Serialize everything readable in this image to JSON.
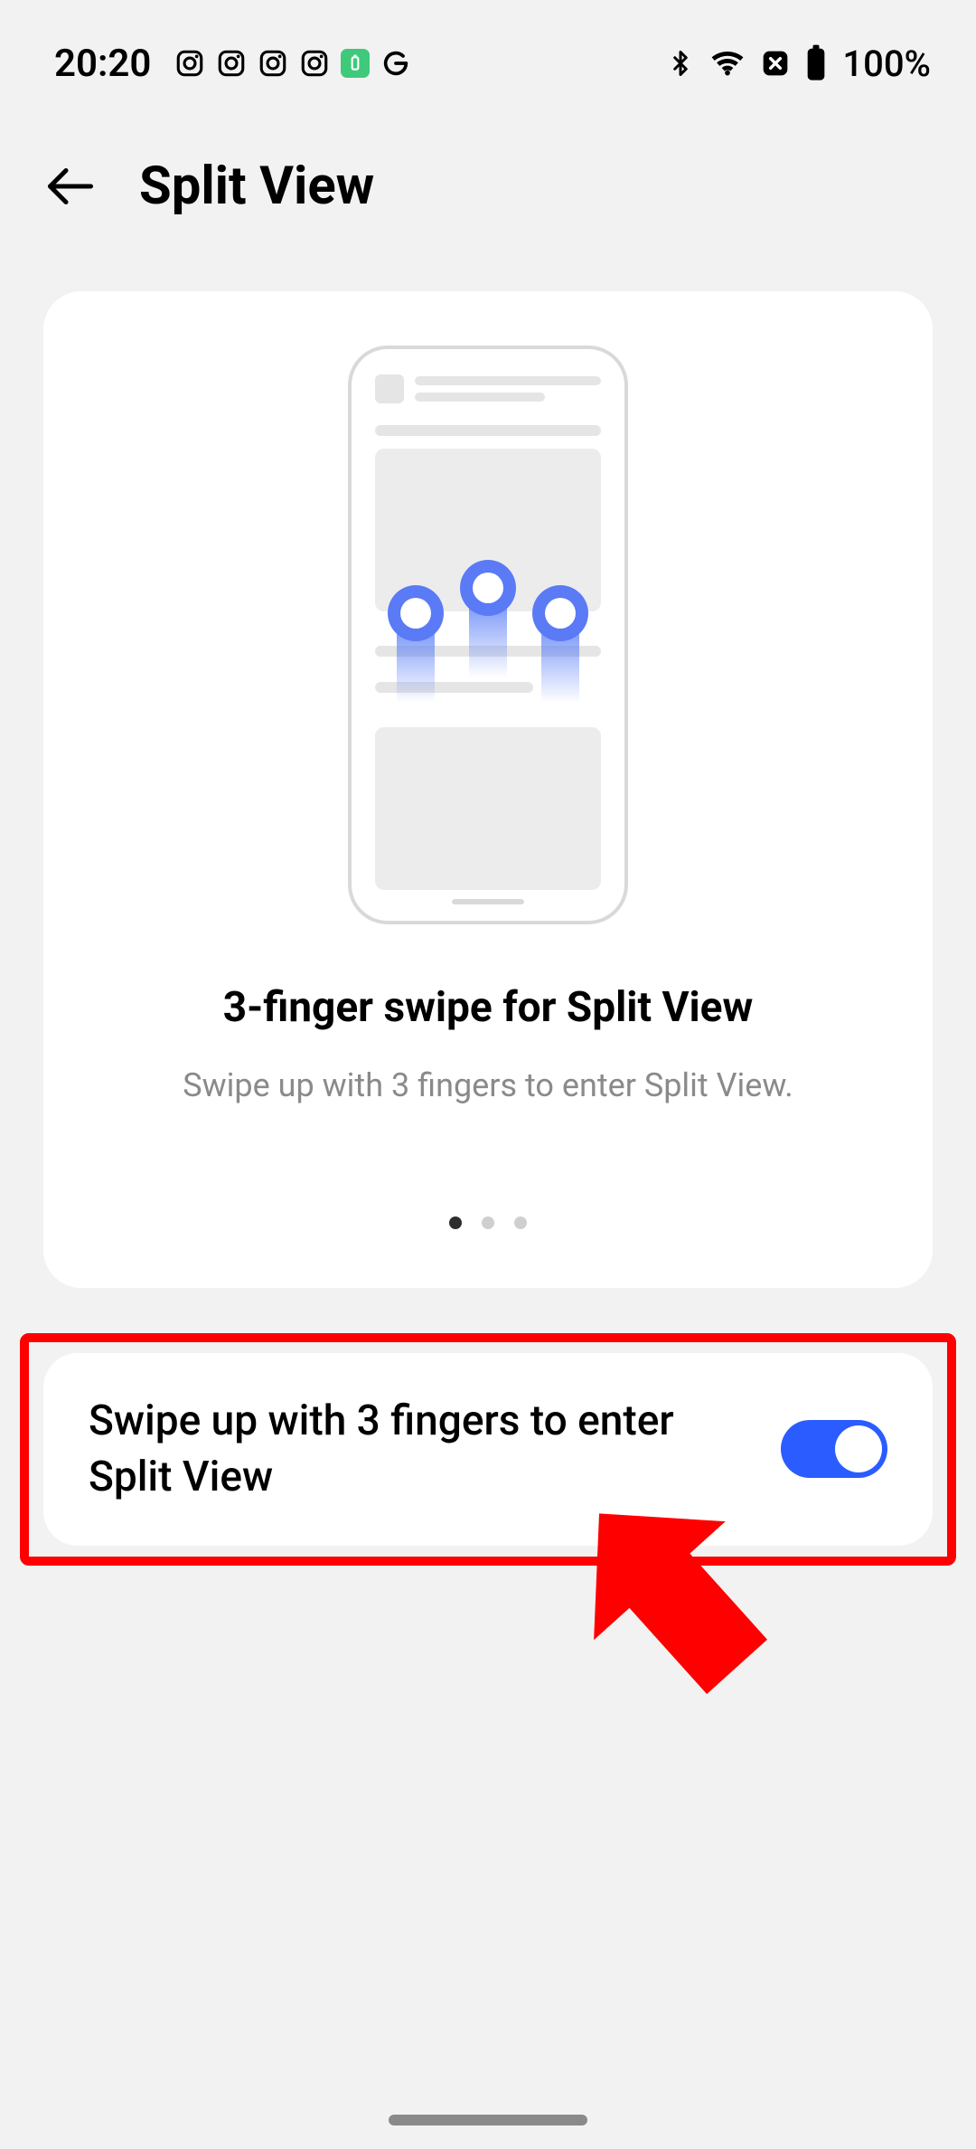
{
  "status": {
    "time": "20:20",
    "battery": "100%"
  },
  "header": {
    "title": "Split View"
  },
  "info": {
    "title": "3-finger swipe for Split View",
    "description": "Swipe up with 3 fingers to enter Split View."
  },
  "setting": {
    "label": "Swipe up with 3 fingers to enter Split View",
    "enabled": true
  }
}
